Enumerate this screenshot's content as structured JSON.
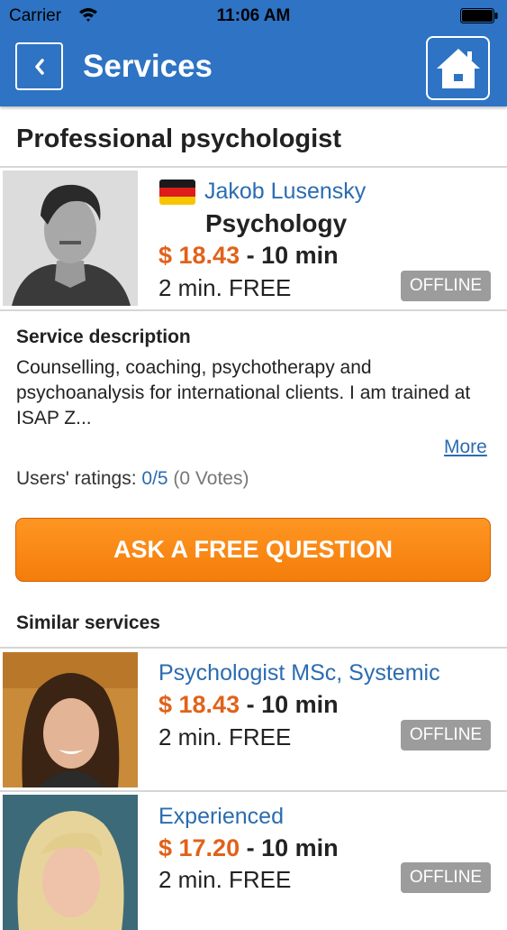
{
  "status_bar": {
    "carrier": "Carrier",
    "time": "11:06 AM"
  },
  "nav": {
    "title": "Services",
    "back_icon": "chevron-left-icon",
    "home_icon": "home-icon"
  },
  "colors": {
    "nav_blue": "#2e73c4",
    "link_blue": "#2b6cb0",
    "price_orange": "#e0621a",
    "cta_orange": "#f7870f",
    "offline_gray": "#9c9c9c"
  },
  "service": {
    "title": "Professional psychologist",
    "provider_name": "Jakob Lusensky",
    "country_flag": "germany-flag-icon",
    "category": "Psychology",
    "price": "$ 18.43",
    "duration": " - 10 min",
    "free_trial": "2 min. FREE",
    "status": "OFFLINE",
    "description_heading": "Service description",
    "description": "Counselling, coaching, psychotherapy and psychoanalysis for international clients. I am trained at ISAP Z...",
    "more_link": "More",
    "ratings_label": "Users' ratings: ",
    "ratings_score": "0/5",
    "ratings_votes": " (0 Votes)"
  },
  "cta": {
    "label": "ASK A FREE QUESTION"
  },
  "similar": {
    "heading": "Similar services",
    "items": [
      {
        "title": "Psychologist MSc, Systemic",
        "price": "$ 18.43",
        "duration": " - 10 min",
        "free_trial": "2 min. FREE",
        "status": "OFFLINE"
      },
      {
        "title": "Experienced",
        "price": "$ 17.20",
        "duration": " - 10 min",
        "free_trial": "2 min. FREE",
        "status": "OFFLINE"
      }
    ]
  }
}
